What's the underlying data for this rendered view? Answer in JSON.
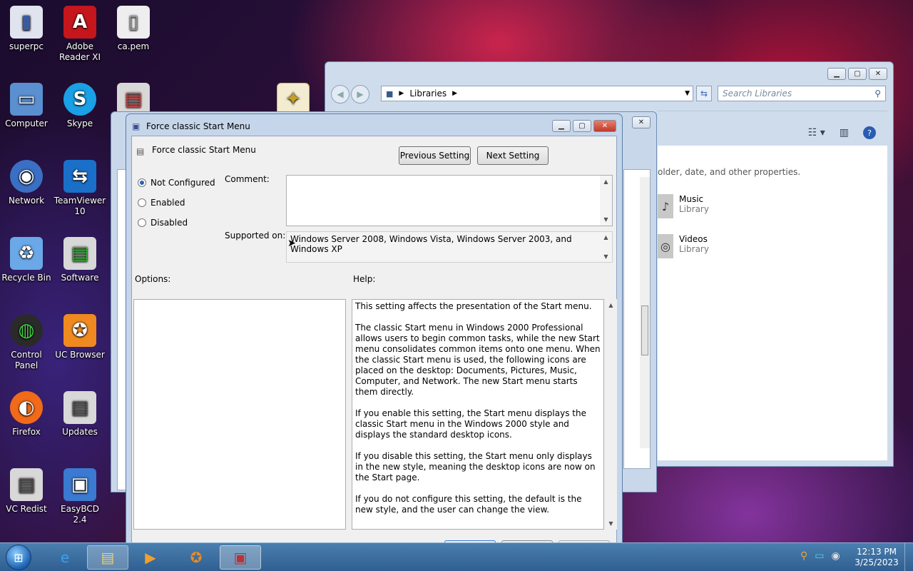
{
  "desktop_icons": [
    {
      "label": "superpc",
      "glyph": "▮",
      "color": "#e8e8f0"
    },
    {
      "label": "Adobe Reader XI",
      "glyph": "A",
      "color": "#c4161c"
    },
    {
      "label": "ca.pem",
      "glyph": "▯",
      "color": "#eeeeee"
    },
    {
      "label": "Computer",
      "glyph": "▭",
      "color": "#5a8fd0"
    },
    {
      "label": "Skype",
      "glyph": "S",
      "color": "#1aa0e6"
    },
    {
      "label": "Network",
      "glyph": "◉",
      "color": "#3a6fc4"
    },
    {
      "label": "TeamViewer 10",
      "glyph": "⇆",
      "color": "#1a70c8"
    },
    {
      "label": "Recycle Bin",
      "glyph": "♻",
      "color": "#6aa8e8"
    },
    {
      "label": "Software",
      "glyph": "▤",
      "color": "#d8d8d8"
    },
    {
      "label": "Control Panel",
      "glyph": "◍",
      "color": "#3a8a3a"
    },
    {
      "label": "UC Browser",
      "glyph": "✪",
      "color": "#f08a20"
    },
    {
      "label": "Firefox",
      "glyph": "◐",
      "color": "#f06a1a"
    },
    {
      "label": "Updates",
      "glyph": "▤",
      "color": "#d8d8d8"
    },
    {
      "label": "VC Redist",
      "glyph": "▤",
      "color": "#d8d8d8"
    },
    {
      "label": "EasyBCD 2.4",
      "glyph": "▣",
      "color": "#3a7ad0"
    }
  ],
  "explorer": {
    "breadcrumb": "Libraries",
    "search_placeholder": "Search Libraries",
    "desc_text": "older, date, and other properties.",
    "items": [
      {
        "name": "Music",
        "type": "Library"
      },
      {
        "name": "Videos",
        "type": "Library"
      }
    ]
  },
  "dialog": {
    "window_title": "Force classic Start Menu",
    "policy_name": "Force classic Start Menu",
    "prev_button": "Previous Setting",
    "next_button": "Next Setting",
    "radio_not_configured": "Not Configured",
    "radio_enabled": "Enabled",
    "radio_disabled": "Disabled",
    "comment_label": "Comment:",
    "supported_label": "Supported on:",
    "supported_value": "Windows Server 2008, Windows Vista, Windows Server 2003, and Windows XP",
    "options_label": "Options:",
    "help_label": "Help:",
    "help_paragraphs": [
      "This setting affects the presentation of the Start menu.",
      "The classic Start menu in Windows 2000 Professional allows users to begin common tasks, while the new Start menu consolidates common items onto one menu. When the classic Start menu is used, the following icons are placed on the desktop: Documents, Pictures, Music, Computer, and Network. The new Start menu starts them directly.",
      "If you enable this setting, the Start menu displays the classic Start menu in the Windows 2000 style and displays the standard desktop icons.",
      "If you disable this setting, the Start menu only displays in the new style, meaning the desktop icons are now on the Start page.",
      "If you do not configure this setting, the default is the new style, and the user can change the view."
    ]
  },
  "taskbar": {
    "time": "12:13 PM",
    "date": "3/25/2023"
  }
}
